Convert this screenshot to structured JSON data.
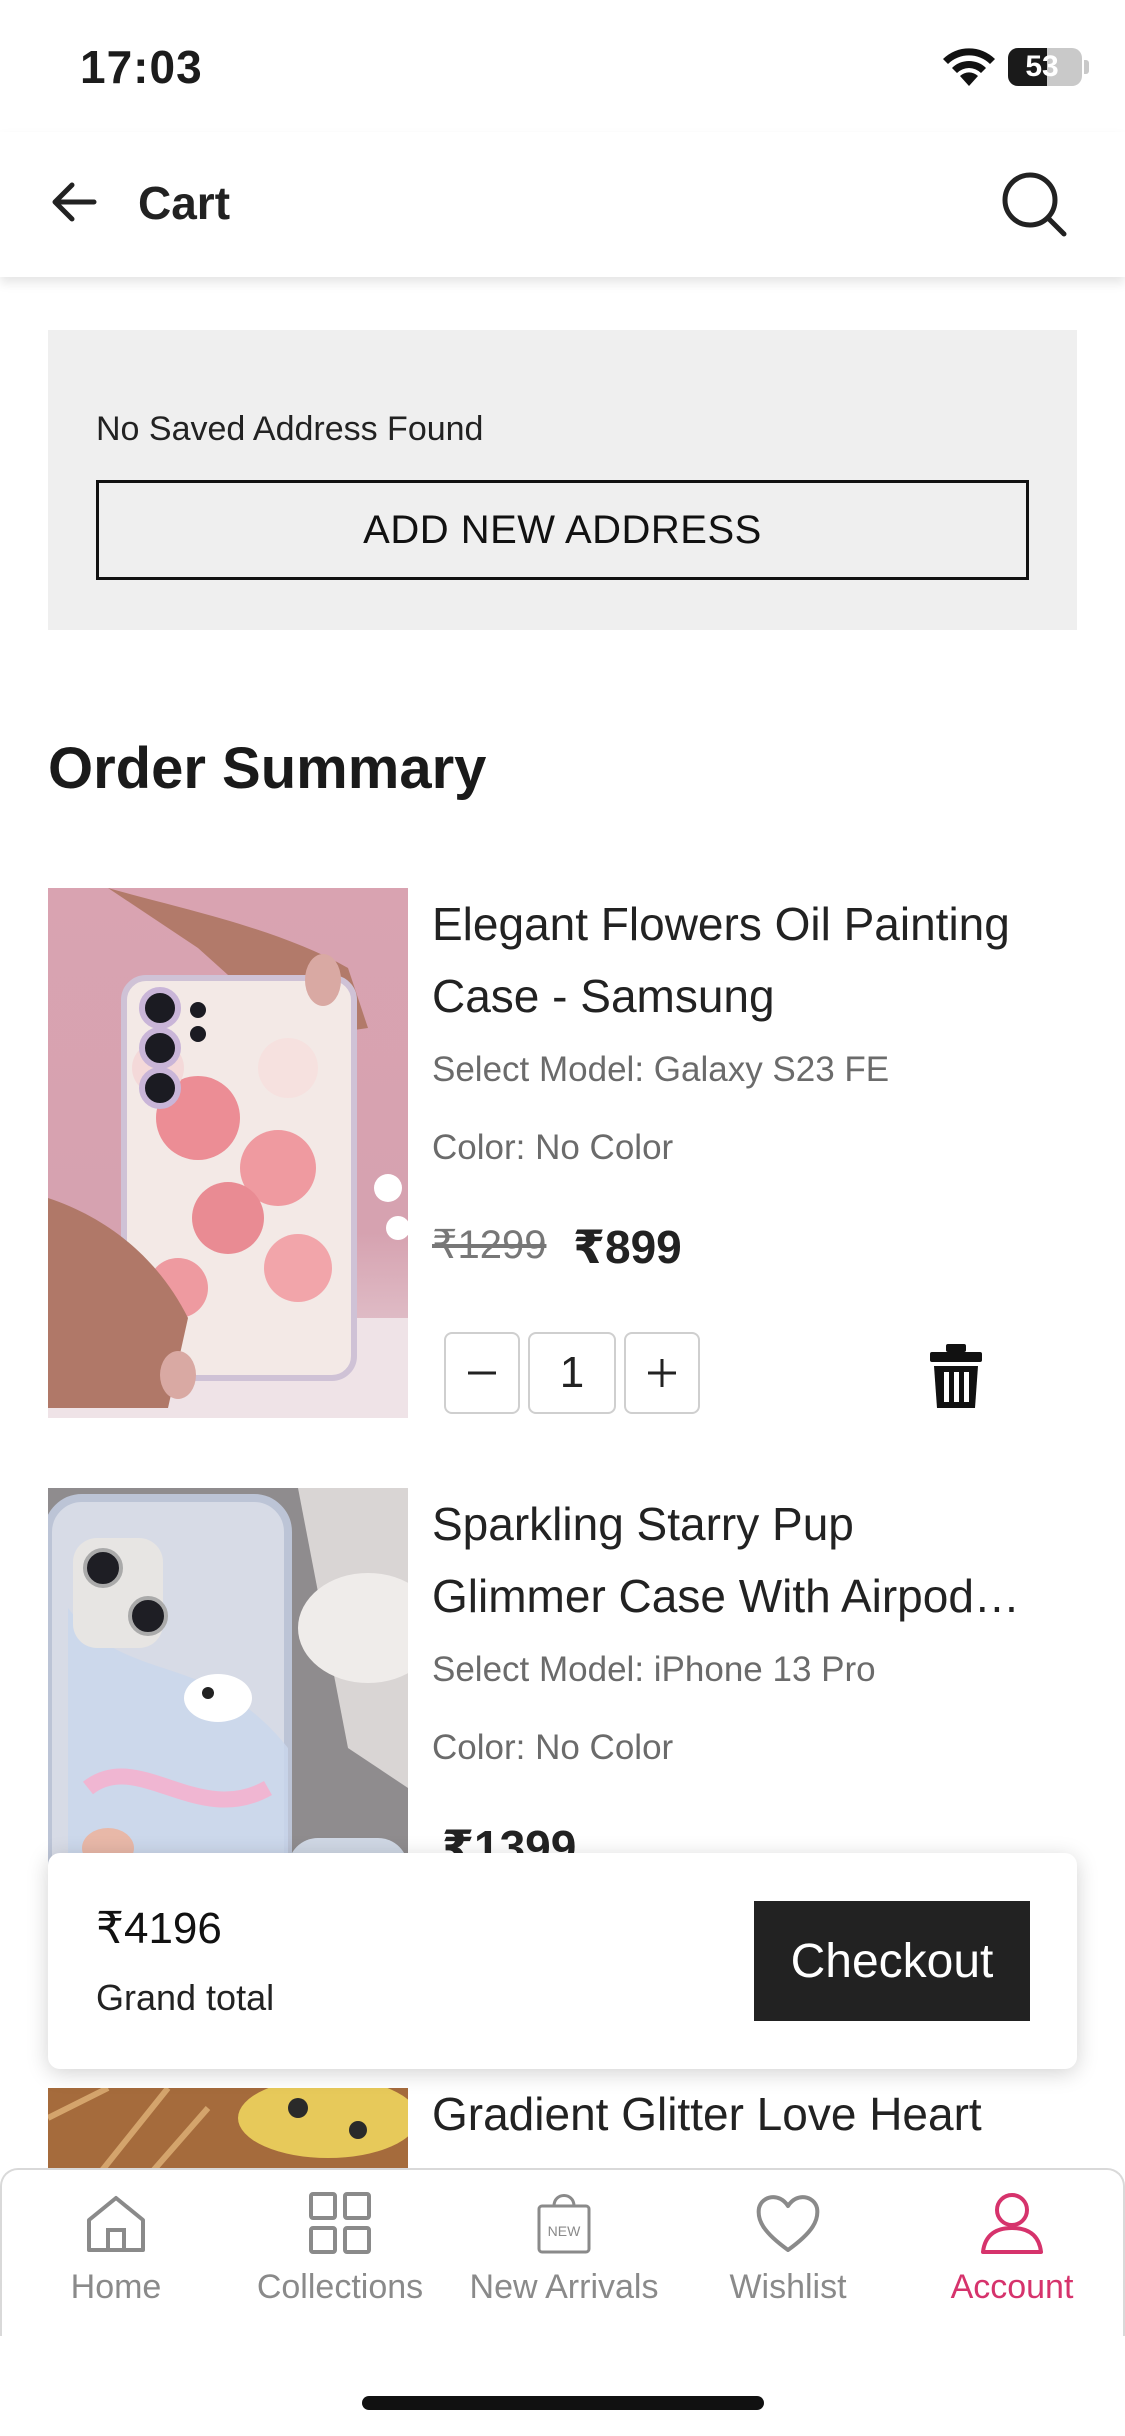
{
  "status_bar": {
    "time": "17:03",
    "battery": "53",
    "battery_level": 0.53
  },
  "header": {
    "title": "Cart"
  },
  "address": {
    "message": "No Saved Address Found",
    "button_label": "ADD NEW ADDRESS"
  },
  "order_summary": {
    "title": "Order Summary",
    "items": [
      {
        "title": "Elegant Flowers Oil Painting Case - Samsung",
        "model": "Select Model: Galaxy S23 FE",
        "color": "Color: No Color",
        "price_old": "₹1299",
        "price_new": "₹899",
        "quantity": "1"
      },
      {
        "title": "Sparkling Starry Pup Glimmer Case With Airpod…",
        "model": "Select Model: iPhone 13 Pro",
        "color": "Color: No Color",
        "price_new": "₹1399"
      },
      {
        "title": "Gradient Glitter Love Heart"
      }
    ]
  },
  "totals": {
    "amount": "₹4196",
    "label": "Grand total",
    "checkout_label": "Checkout"
  },
  "bottom_nav": {
    "active_color": "#d6336c",
    "items": [
      {
        "label": "Home",
        "icon": "home-icon"
      },
      {
        "label": "Collections",
        "icon": "grid-icon"
      },
      {
        "label": "New Arrivals",
        "icon": "new-bag-icon",
        "badge": "NEW"
      },
      {
        "label": "Wishlist",
        "icon": "heart-icon"
      },
      {
        "label": "Account",
        "icon": "user-icon",
        "active": true
      }
    ]
  }
}
